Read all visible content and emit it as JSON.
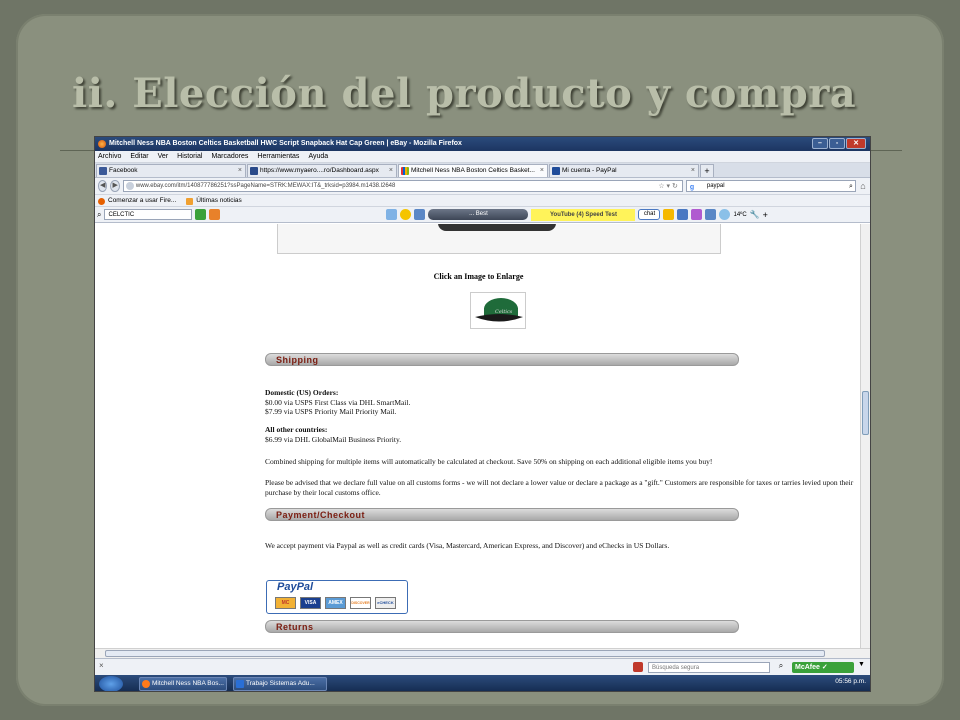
{
  "slide_title": "ii. Elección del producto y compra",
  "browser": {
    "window_title": "Mitchell Ness NBA Boston Celtics Basketball HWC Script Snapback Hat Cap Green | eBay - Mozilla Firefox",
    "window_buttons": [
      "–",
      "▫",
      "✕"
    ],
    "menu": [
      "Archivo",
      "Editar",
      "Ver",
      "Historial",
      "Marcadores",
      "Herramientas",
      "Ayuda"
    ],
    "tabs": [
      {
        "label": "Facebook",
        "icon": "facebook-icon",
        "color": "#3b5998"
      },
      {
        "label": "https://www.myaero....ro/Dashboard.aspx",
        "icon": "myaero-icon",
        "color": "#2a4a8a"
      },
      {
        "label": "Mitchell Ness NBA Boston Celtics Basket...",
        "icon": "ebay-icon",
        "color": "#e53238"
      },
      {
        "label": "Mi cuenta - PayPal",
        "icon": "paypal-icon",
        "color": "#1f4c9a"
      }
    ],
    "new_tab": "+",
    "url": "www.ebay.com/itm/140877786251?ssPageName=STRK:MEWAX:IT&_trksid=p3984.m1438.l2648",
    "search_value": "paypal",
    "bookmarks": [
      "Comenzar a usar Fire...",
      "Últimas noticias"
    ],
    "toolbar": {
      "search_value": "CELCTIC",
      "player_text": "... Best",
      "ad_text": "YouTube (4) Speed Test",
      "chat_label": "chat",
      "weather": "14ºC"
    }
  },
  "page": {
    "enlarge_text": "Click an Image to Enlarge",
    "shipping": {
      "header": "Shipping",
      "domestic_title": "Domestic (US) Orders:",
      "domestic_lines": [
        "$0.00 via USPS First Class via DHL SmartMail.",
        "$7.99 via USPS Priority Mail Priority Mail."
      ],
      "other_title": "All other countries:",
      "other_lines": [
        "$6.99 via DHL GlobalMail Business Priority."
      ],
      "combined_note": "Combined shipping for multiple items will automatically be calculated at checkout. Save 50% on shipping on each additional eligible items you buy!",
      "customs_note": "Please be advised that we declare full value on all customs forms - we will not declare a lower value or declare a package as a \"gift.\" Customers are responsible for taxes or tarries levied upon their purchase by their local customs office."
    },
    "payment": {
      "header": "Payment/Checkout",
      "text": "We accept payment via Paypal as well as credit cards (Visa, Mastercard, American Express, and Discover) and eChecks in US Dollars.",
      "logo_text": "PayPal",
      "cards": [
        "MC",
        "VISA",
        "AMEX",
        "DISCOVER",
        "eCHECK"
      ]
    },
    "returns": {
      "header": "Returns"
    }
  },
  "statusbar": {
    "close_glyph": "×",
    "safe_search_placeholder": "Búsqueda segura",
    "mcafee_label": "McAfee"
  },
  "taskbar": {
    "tasks": [
      {
        "label": "Mitchell Ness NBA Bos...",
        "color": "#ff7a1a"
      },
      {
        "label": "Trabajo Sistemas Adu...",
        "color": "#2a6fd6"
      }
    ],
    "clock": "05:56 p.m."
  }
}
